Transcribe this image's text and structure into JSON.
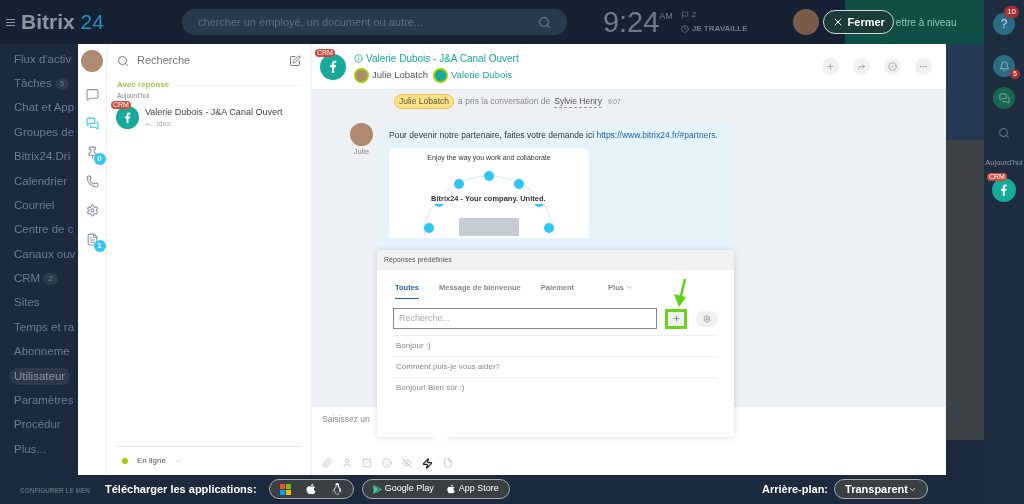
{
  "header": {
    "logo": "Bitrix",
    "logo_suffix": "24",
    "search_placeholder": "chercher un employé, un document ou autre...",
    "time": "9:24",
    "ampm": "AM",
    "flag_count": "2",
    "work_status": "JE TRAVAILLE",
    "close_button": "Fermer",
    "upgrade": "ettre à niveau"
  },
  "left_menu": {
    "items": [
      {
        "label": "Flux d'activ",
        "selected": false
      },
      {
        "label": "Tâches",
        "badge": "5",
        "selected": false
      },
      {
        "label": "Chat et App",
        "selected": false
      },
      {
        "label": "Groupes de",
        "selected": false
      },
      {
        "label": "Bitrix24.Dri",
        "selected": false
      },
      {
        "label": "Calendrier",
        "selected": false
      },
      {
        "label": "Courriel",
        "selected": false
      },
      {
        "label": "Centre de c",
        "selected": false
      },
      {
        "label": "Canaux ouv",
        "selected": false
      },
      {
        "label": "CRM",
        "badge": "2",
        "selected": false
      },
      {
        "label": "Sites",
        "selected": false
      },
      {
        "label": "Temps et ra",
        "selected": false
      },
      {
        "label": "Abonneme",
        "selected": false
      },
      {
        "label": "Utilisateur",
        "selected": true
      },
      {
        "label": "Paramètres",
        "selected": false
      },
      {
        "label": "Procédur",
        "selected": false
      },
      {
        "label": "Plus...",
        "selected": false
      }
    ],
    "footer": "CONFIGURER LE MEN"
  },
  "right_bar": {
    "help_icon": "?",
    "help_badge": "10",
    "bell_badge": "5",
    "today": "Aujourd'hui",
    "recent_badge": "CRM"
  },
  "messenger": {
    "nav": [
      {
        "kind": "chats",
        "selected": false
      },
      {
        "kind": "openlines",
        "selected": true
      },
      {
        "kind": "pin",
        "badge": "0",
        "selected": false
      },
      {
        "kind": "phone",
        "selected": false
      },
      {
        "kind": "settings",
        "selected": false
      },
      {
        "kind": "notes",
        "badge": "1",
        "selected": false
      }
    ],
    "recent": {
      "search_placeholder": "Recherche",
      "section": "Avec réponse",
      "date": "Aujourd'hui",
      "items": [
        {
          "badge": "CRM",
          "name": "Valerie Dubois - J&A Canal Ouvert",
          "preview": ":idea:",
          "selected": false
        }
      ],
      "status": "En ligne"
    },
    "chat": {
      "badge": "CRM",
      "title": "Valerie Dubois - J&A Canal Ouvert",
      "members": [
        {
          "name": "Julie Lobatch",
          "kind": "operator"
        },
        {
          "name": "Valerie Dubois",
          "kind": "client"
        }
      ],
      "system": {
        "actor": "Julie Lobatch",
        "text": "a pris la conversation de",
        "target": "Sylvie Henry",
        "time": "9:07"
      },
      "message": {
        "author": "Julie",
        "text": "Pour devenir notre partenaire, faites votre demande ici",
        "link": "https://www.bitrix24.fr/#partners.",
        "preview_title": "Enjoy the way you work and collaborate",
        "preview_caption": "Bitrix24 - Your company. United."
      },
      "input_placeholder": "Saisissez un",
      "tools": [
        {
          "kind": "attach",
          "selected": false
        },
        {
          "kind": "user",
          "selected": false
        },
        {
          "kind": "file",
          "selected": false
        },
        {
          "kind": "smile",
          "selected": false
        },
        {
          "kind": "hide",
          "selected": false
        },
        {
          "kind": "quick",
          "selected": true
        },
        {
          "kind": "doc",
          "selected": false
        }
      ]
    },
    "canned": {
      "title": "Réponses prédéfinies",
      "tabs": [
        {
          "label": "Toutes",
          "selected": true
        },
        {
          "label": "Message de bienvenue",
          "selected": false
        },
        {
          "label": "Paiement",
          "selected": false
        },
        {
          "label": "Plus",
          "selected": false,
          "dropdown": true
        }
      ],
      "search_placeholder": "Recherche...",
      "add_highlighted": true,
      "items": [
        "Bonjour :)",
        "Comment puis-je vous aider?",
        "Bonjour! Bien sûr :)"
      ]
    }
  },
  "footer": {
    "apps_label": "Télécharger les applications:",
    "stores": [
      "Google Play",
      "App Store"
    ],
    "background_label": "Arrière-plan:",
    "background_value": "Transparent"
  }
}
